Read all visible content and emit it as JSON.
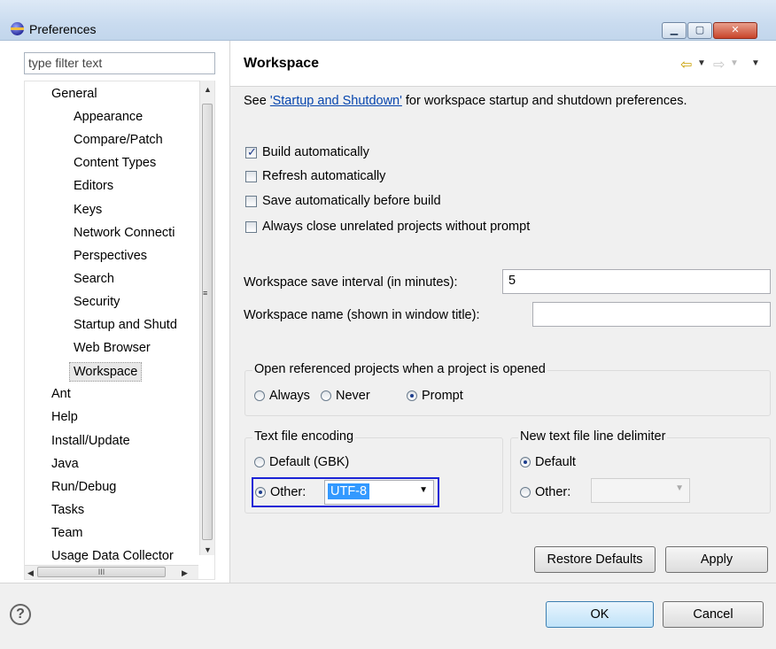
{
  "window": {
    "title": "Preferences",
    "minimize_glyph": "▁",
    "maximize_glyph": "▢",
    "close_glyph": "✕"
  },
  "sidebar": {
    "filter_placeholder": "type filter text",
    "items": [
      {
        "label": "General",
        "level": 0
      },
      {
        "label": "Appearance",
        "level": 1
      },
      {
        "label": "Compare/Patch",
        "level": 1
      },
      {
        "label": "Content Types",
        "level": 1
      },
      {
        "label": "Editors",
        "level": 1
      },
      {
        "label": "Keys",
        "level": 1
      },
      {
        "label": "Network Connecti",
        "level": 1
      },
      {
        "label": "Perspectives",
        "level": 1
      },
      {
        "label": "Search",
        "level": 1
      },
      {
        "label": "Security",
        "level": 1
      },
      {
        "label": "Startup and Shutd",
        "level": 1
      },
      {
        "label": "Web Browser",
        "level": 1
      },
      {
        "label": "Workspace",
        "level": 1,
        "selected": true
      },
      {
        "label": "Ant",
        "level": 0
      },
      {
        "label": "Help",
        "level": 0
      },
      {
        "label": "Install/Update",
        "level": 0
      },
      {
        "label": "Java",
        "level": 0
      },
      {
        "label": "Run/Debug",
        "level": 0
      },
      {
        "label": "Tasks",
        "level": 0
      },
      {
        "label": "Team",
        "level": 0
      },
      {
        "label": "Usage Data Collector",
        "level": 0
      }
    ],
    "hscroll_grip": "III"
  },
  "page": {
    "title": "Workspace",
    "desc_prefix": "See ",
    "desc_link": "'Startup and Shutdown'",
    "desc_suffix": " for workspace startup and shutdown preferences.",
    "checkboxes": [
      {
        "label": "Build automatically",
        "checked": true
      },
      {
        "label": "Refresh automatically",
        "checked": false
      },
      {
        "label": "Save automatically before build",
        "checked": false
      },
      {
        "label": "Always close unrelated projects without prompt",
        "checked": false
      }
    ],
    "save_interval_label": "Workspace save interval (in minutes):",
    "save_interval_value": "5",
    "workspace_name_label": "Workspace name (shown in window title):",
    "workspace_name_value": "",
    "open_projects": {
      "label": "Open referenced projects when a project is opened",
      "options": [
        "Always",
        "Never",
        "Prompt"
      ],
      "selected": "Prompt"
    },
    "encoding": {
      "label": "Text file encoding",
      "default_label": "Default (GBK)",
      "other_label": "Other:",
      "other_value": "UTF-8",
      "selected": "Other"
    },
    "line_delimiter": {
      "label": "New text file line delimiter",
      "default_label": "Default",
      "other_label": "Other:",
      "selected": "Default"
    },
    "restore_defaults": "Restore Defaults",
    "apply": "Apply"
  },
  "footer": {
    "help_glyph": "?",
    "ok": "OK",
    "cancel": "Cancel"
  }
}
